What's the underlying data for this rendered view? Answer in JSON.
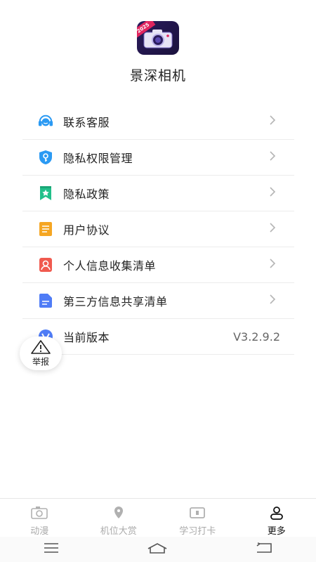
{
  "app": {
    "name": "景深相机",
    "logo_badge": "2025",
    "logo_icon": "camera-icon"
  },
  "menu": {
    "items": [
      {
        "label": "联系客服",
        "icon": "headset-icon",
        "color": "#2b9af3"
      },
      {
        "label": "隐私权限管理",
        "icon": "shield-key-icon",
        "color": "#2b9af3"
      },
      {
        "label": "隐私政策",
        "icon": "bookmark-star-icon",
        "color": "#22c08a"
      },
      {
        "label": "用户协议",
        "icon": "document-icon",
        "color": "#f5a623"
      },
      {
        "label": "个人信息收集清单",
        "icon": "person-card-icon",
        "color": "#f05a4f"
      },
      {
        "label": "第三方信息共享清单",
        "icon": "file-icon",
        "color": "#4f7cf6"
      },
      {
        "label": "当前版本",
        "icon": "version-v-icon",
        "color": "#4f7cf6",
        "value": "V3.2.9.2"
      }
    ]
  },
  "report": {
    "label": "举报",
    "icon": "warning-icon"
  },
  "bottom_nav": {
    "tabs": [
      {
        "label": "动漫",
        "icon": "camera-outline-icon",
        "active": false
      },
      {
        "label": "机位大赏",
        "icon": "location-pin-icon",
        "active": false
      },
      {
        "label": "学习打卡",
        "icon": "card-icon",
        "active": false
      },
      {
        "label": "更多",
        "icon": "person-icon",
        "active": true
      }
    ]
  },
  "system_bar": {
    "buttons": [
      "menu-icon",
      "home-icon",
      "back-icon"
    ]
  }
}
